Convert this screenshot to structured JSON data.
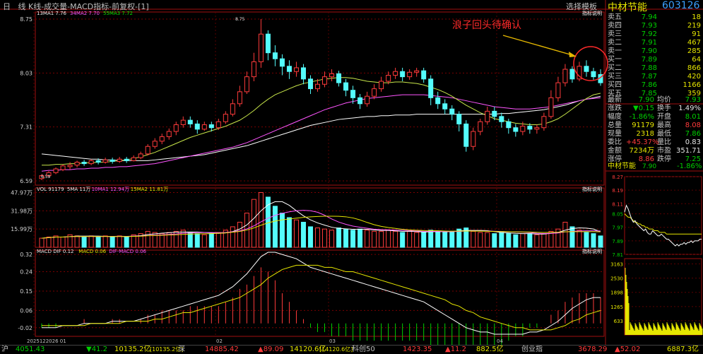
{
  "header": {
    "period_day": "日",
    "period_line": "线",
    "title": "K线-成交量-MACD指标-前复权-[1]",
    "select_template": "选择模板",
    "stock_name": "中材节能",
    "stock_code": "603126"
  },
  "price_panel": {
    "ma_legend": [
      {
        "label": "13MA1 7.76",
        "color": "#e8e8e8"
      },
      {
        "label": "34MA2 7.70",
        "color": "#ff55ff"
      },
      {
        "label": "55MA3 7.72",
        "color": "#00e000"
      }
    ],
    "indicator_btn": "指标说明",
    "y_ticks": [
      "8.75",
      "8.03",
      "7.31",
      "6.59"
    ],
    "high_label": "8.75",
    "low_label": "6.59",
    "annotation": "浪子回头待确认"
  },
  "volume_panel": {
    "legend": [
      {
        "label": "VOL 91179",
        "color": "#e8e8e8"
      },
      {
        "label": "5MA 11万",
        "color": "#e8e8e8"
      },
      {
        "label": "10MA1 12.94万",
        "color": "#ff55ff"
      },
      {
        "label": "15MA2 11.81万",
        "color": "#e6e600"
      }
    ],
    "indicator_btn": "指标说明",
    "y_ticks": [
      "47.97万",
      "31.98万",
      "15.99万"
    ]
  },
  "macd_panel": {
    "legend": [
      {
        "label": "MACD DIF 0.12",
        "color": "#e8e8e8"
      },
      {
        "label": "MACD 0.06",
        "color": "#e6e600"
      },
      {
        "label": "DIF-MACD 0.06",
        "color": "#ff55ff"
      }
    ],
    "indicator_btn": "指标说明",
    "y_ticks": [
      "0.32",
      "0.24",
      "0.15",
      "0.06",
      "-0.02"
    ]
  },
  "x_labels": [
    "2025122026 01",
    "02",
    "03",
    "04"
  ],
  "order_book": {
    "asks": [
      {
        "label": "卖五",
        "price": "7.94",
        "vol": "18"
      },
      {
        "label": "卖四",
        "price": "7.93",
        "vol": "219"
      },
      {
        "label": "卖三",
        "price": "7.92",
        "vol": "91"
      },
      {
        "label": "卖二",
        "price": "7.91",
        "vol": "467"
      },
      {
        "label": "卖一",
        "price": "7.90",
        "vol": "285"
      }
    ],
    "bids": [
      {
        "label": "买一",
        "price": "7.89",
        "vol": "64"
      },
      {
        "label": "买二",
        "price": "7.88",
        "vol": "866"
      },
      {
        "label": "买三",
        "price": "7.87",
        "vol": "420"
      },
      {
        "label": "买四",
        "price": "7.86",
        "vol": "1166"
      },
      {
        "label": "买五",
        "price": "7.85",
        "vol": "359"
      }
    ]
  },
  "stats": [
    {
      "l1": "最新",
      "v1": "7.90",
      "c1": "green",
      "l2": "均价",
      "v2": "7.93",
      "c2": "green"
    },
    {
      "l1": "涨跌",
      "v1": "▼0.15",
      "c1": "green",
      "l2": "换手",
      "v2": "1.49%",
      "c2": "white"
    },
    {
      "l1": "幅度",
      "v1": "-1.86%",
      "c1": "green",
      "l2": "开盘",
      "v2": "8.01",
      "c2": "green"
    },
    {
      "l1": "总量",
      "v1": "91179",
      "c1": "yellow",
      "l2": "最高",
      "v2": "8.08",
      "c2": "red"
    },
    {
      "l1": "现量",
      "v1": "2318",
      "c1": "yellow",
      "l2": "最低",
      "v2": "7.86",
      "c2": "green"
    },
    {
      "l1": "委比",
      "v1": "+45.37%",
      "c1": "red",
      "l2": "量比",
      "v2": "0.83",
      "c2": "white"
    },
    {
      "l1": "金额",
      "v1": "7234万",
      "c1": "yellow",
      "l2": "市盈",
      "v2": "351.71",
      "c2": "white"
    },
    {
      "l1": "涨停",
      "v1": "8.86",
      "c1": "red",
      "l2": "跌停",
      "v2": "7.25",
      "c2": "green"
    }
  ],
  "mini_chart": {
    "name": "中材节能",
    "price": "7.90",
    "change": "-1.86%",
    "price_ticks": [
      "8.27",
      "8.19",
      "8.11",
      "8.05",
      "7.97",
      "7.89",
      "7.81"
    ],
    "vol_ticks": [
      "3163",
      "2530",
      "1898",
      "1265",
      "633"
    ]
  },
  "footer": {
    "sh_label": "沪",
    "sh_val": "4051.43",
    "sh_chg": "▼41.2",
    "sh_amt": "10135.2亿",
    "sh_amt2": "[10135.2亿]",
    "sz_label": "深",
    "sz_val": "14885.42",
    "sz_chg": "▲89.09",
    "sz_amt": "14120.6亿",
    "sz_amt2": "[14120.6亿]",
    "k50_label": "科创50",
    "k50_val": "1423.35",
    "k50_chg": "▲11.2",
    "cy_label": "创业指",
    "cy_val": "882.5亿",
    "cy_val2": "3678.29",
    "cy_chg": "▲52.02",
    "last_val": "6887.3亿"
  },
  "chart_data": {
    "type": "candlestick",
    "title": "K线-成交量-MACD指标-前复权",
    "price_range": [
      6.59,
      8.75
    ],
    "candles": [
      [
        6.62,
        6.66,
        6.6,
        6.68
      ],
      [
        6.66,
        6.7,
        6.64,
        6.72
      ],
      [
        6.7,
        6.75,
        6.68,
        6.77
      ],
      [
        6.74,
        6.79,
        6.72,
        6.81
      ],
      [
        6.78,
        6.8,
        6.74,
        6.84
      ],
      [
        6.8,
        6.84,
        6.77,
        6.86
      ],
      [
        6.84,
        6.82,
        6.79,
        6.87
      ],
      [
        6.82,
        6.86,
        6.8,
        6.88
      ],
      [
        6.86,
        6.84,
        6.81,
        6.89
      ],
      [
        6.84,
        6.87,
        6.82,
        6.9
      ],
      [
        6.87,
        6.85,
        6.82,
        6.9
      ],
      [
        6.85,
        6.88,
        6.83,
        6.91
      ],
      [
        6.88,
        6.86,
        6.83,
        6.91
      ],
      [
        6.86,
        6.9,
        6.85,
        6.93
      ],
      [
        6.9,
        6.95,
        6.88,
        6.98
      ],
      [
        6.95,
        7.05,
        6.93,
        7.08
      ],
      [
        7.05,
        7.12,
        7.02,
        7.16
      ],
      [
        7.12,
        7.18,
        7.08,
        7.22
      ],
      [
        7.18,
        7.25,
        7.14,
        7.29
      ],
      [
        7.25,
        7.34,
        7.2,
        7.38
      ],
      [
        7.34,
        7.4,
        7.3,
        7.45
      ],
      [
        7.4,
        7.35,
        7.3,
        7.45
      ],
      [
        7.35,
        7.28,
        7.22,
        7.4
      ],
      [
        7.28,
        7.34,
        7.26,
        7.38
      ],
      [
        7.34,
        7.3,
        7.25,
        7.38
      ],
      [
        7.3,
        7.38,
        7.27,
        7.42
      ],
      [
        7.38,
        7.48,
        7.35,
        7.52
      ],
      [
        7.48,
        7.62,
        7.45,
        7.68
      ],
      [
        7.62,
        7.78,
        7.58,
        7.86
      ],
      [
        7.78,
        7.98,
        7.75,
        8.05
      ],
      [
        7.98,
        8.18,
        7.92,
        8.3
      ],
      [
        8.18,
        8.55,
        8.1,
        8.75
      ],
      [
        8.55,
        8.3,
        8.2,
        8.6
      ],
      [
        8.3,
        8.22,
        8.12,
        8.4
      ],
      [
        8.22,
        8.12,
        8.0,
        8.28
      ],
      [
        8.12,
        8.05,
        7.95,
        8.2
      ],
      [
        8.05,
        8.1,
        7.98,
        8.18
      ],
      [
        8.1,
        7.95,
        7.88,
        8.15
      ],
      [
        7.95,
        7.82,
        7.75,
        8.0
      ],
      [
        7.82,
        7.88,
        7.78,
        7.95
      ],
      [
        7.88,
        7.98,
        7.84,
        8.05
      ],
      [
        7.98,
        8.02,
        7.92,
        8.08
      ],
      [
        8.02,
        7.9,
        7.85,
        8.06
      ],
      [
        7.9,
        7.8,
        7.72,
        7.95
      ],
      [
        7.8,
        7.7,
        7.62,
        7.86
      ],
      [
        7.7,
        7.62,
        7.55,
        7.75
      ],
      [
        7.62,
        7.72,
        7.58,
        7.78
      ],
      [
        7.72,
        7.82,
        7.68,
        7.88
      ],
      [
        7.82,
        7.92,
        7.78,
        7.98
      ],
      [
        7.92,
        8.0,
        7.88,
        8.05
      ],
      [
        8.0,
        8.05,
        7.95,
        8.1
      ],
      [
        8.05,
        7.98,
        7.92,
        8.1
      ],
      [
        7.98,
        8.04,
        7.94,
        8.08
      ],
      [
        8.04,
        8.06,
        7.98,
        8.1
      ],
      [
        8.06,
        7.95,
        7.9,
        8.1
      ],
      [
        7.95,
        7.7,
        7.6,
        8.0
      ],
      [
        7.7,
        7.62,
        7.55,
        7.78
      ],
      [
        7.62,
        7.55,
        7.48,
        7.68
      ],
      [
        7.55,
        7.48,
        7.4,
        7.6
      ],
      [
        7.48,
        7.35,
        7.25,
        7.52
      ],
      [
        7.35,
        7.05,
        6.98,
        7.4
      ],
      [
        7.05,
        7.25,
        7.0,
        7.3
      ],
      [
        7.25,
        7.38,
        7.2,
        7.42
      ],
      [
        7.38,
        7.52,
        7.34,
        7.58
      ],
      [
        7.52,
        7.45,
        7.4,
        7.58
      ],
      [
        7.45,
        7.38,
        7.3,
        7.5
      ],
      [
        7.38,
        7.3,
        7.22,
        7.42
      ],
      [
        7.3,
        7.25,
        7.18,
        7.35
      ],
      [
        7.25,
        7.32,
        7.2,
        7.38
      ],
      [
        7.32,
        7.28,
        7.22,
        7.36
      ],
      [
        7.28,
        7.3,
        7.22,
        7.34
      ],
      [
        7.3,
        7.45,
        7.26,
        7.5
      ],
      [
        7.45,
        7.7,
        7.42,
        7.8
      ],
      [
        7.7,
        7.9,
        7.65,
        7.98
      ],
      [
        7.9,
        8.08,
        7.85,
        8.15
      ],
      [
        8.08,
        7.95,
        7.9,
        8.12
      ],
      [
        7.95,
        8.12,
        7.92,
        8.18
      ],
      [
        8.12,
        8.05,
        7.98,
        8.2
      ],
      [
        8.05,
        7.98,
        7.94,
        8.1
      ],
      [
        8.01,
        7.9,
        7.86,
        8.08
      ]
    ],
    "ma13": [
      6.8,
      6.8,
      6.81,
      6.81,
      6.82,
      6.82,
      6.83,
      6.83,
      6.84,
      6.84,
      6.85,
      6.86,
      6.87,
      6.89,
      6.91,
      6.94,
      6.97,
      7.01,
      7.05,
      7.09,
      7.13,
      7.17,
      7.2,
      7.23,
      7.26,
      7.29,
      7.32,
      7.36,
      7.4,
      7.46,
      7.53,
      7.61,
      7.68,
      7.74,
      7.78,
      7.82,
      7.86,
      7.89,
      7.91,
      7.93,
      7.95,
      7.96,
      7.97,
      7.97,
      7.96,
      7.94,
      7.92,
      7.91,
      7.9,
      7.9,
      7.91,
      7.91,
      7.9,
      7.89,
      7.87,
      7.84,
      7.81,
      7.77,
      7.72,
      7.66,
      7.6,
      7.55,
      7.5,
      7.46,
      7.42,
      7.4,
      7.38,
      7.36,
      7.35,
      7.34,
      7.34,
      7.35,
      7.38,
      7.42,
      7.48,
      7.55,
      7.62,
      7.69,
      7.74,
      7.76
    ],
    "ma34": [
      6.72,
      6.73,
      6.73,
      6.74,
      6.74,
      6.75,
      6.75,
      6.76,
      6.76,
      6.77,
      6.77,
      6.78,
      6.78,
      6.79,
      6.8,
      6.81,
      6.82,
      6.84,
      6.86,
      6.88,
      6.9,
      6.92,
      6.94,
      6.96,
      6.98,
      7.0,
      7.02,
      7.04,
      7.07,
      7.1,
      7.14,
      7.18,
      7.22,
      7.26,
      7.3,
      7.34,
      7.38,
      7.42,
      7.46,
      7.5,
      7.54,
      7.57,
      7.6,
      7.63,
      7.65,
      7.67,
      7.69,
      7.7,
      7.71,
      7.72,
      7.73,
      7.74,
      7.74,
      7.74,
      7.74,
      7.73,
      7.72,
      7.71,
      7.7,
      7.68,
      7.66,
      7.64,
      7.62,
      7.6,
      7.58,
      7.57,
      7.56,
      7.55,
      7.55,
      7.55,
      7.56,
      7.57,
      7.58,
      7.6,
      7.62,
      7.64,
      7.66,
      7.68,
      7.69,
      7.7
    ],
    "ma55": [
      6.95,
      6.94,
      6.93,
      6.92,
      6.91,
      6.9,
      6.89,
      6.88,
      6.88,
      6.87,
      6.87,
      6.86,
      6.86,
      6.86,
      6.86,
      6.86,
      6.87,
      6.88,
      6.89,
      6.9,
      6.91,
      6.92,
      6.93,
      6.94,
      6.96,
      6.98,
      7.0,
      7.02,
      7.04,
      7.06,
      7.09,
      7.12,
      7.15,
      7.18,
      7.21,
      7.24,
      7.27,
      7.3,
      7.33,
      7.35,
      7.37,
      7.39,
      7.41,
      7.42,
      7.43,
      7.44,
      7.45,
      7.45,
      7.46,
      7.46,
      7.47,
      7.47,
      7.47,
      7.48,
      7.48,
      7.48,
      7.48,
      7.48,
      7.48,
      7.48,
      7.48,
      7.48,
      7.48,
      7.48,
      7.48,
      7.49,
      7.49,
      7.5,
      7.51,
      7.52,
      7.53,
      7.54,
      7.56,
      7.58,
      7.6,
      7.63,
      7.66,
      7.68,
      7.7,
      7.72
    ],
    "volume_range": [
      0,
      52
    ],
    "volume": [
      8,
      9,
      10,
      9,
      11,
      10,
      9,
      10,
      9,
      10,
      9,
      10,
      9,
      11,
      12,
      14,
      13,
      12,
      13,
      14,
      15,
      13,
      12,
      11,
      12,
      13,
      15,
      18,
      22,
      30,
      42,
      48,
      44,
      36,
      30,
      26,
      24,
      22,
      18,
      17,
      16,
      15,
      17,
      16,
      15,
      16,
      15,
      14,
      14,
      15,
      14,
      13,
      14,
      13,
      13,
      15,
      14,
      13,
      14,
      16,
      17,
      14,
      13,
      13,
      12,
      13,
      12,
      11,
      12,
      12,
      11,
      12,
      14,
      16,
      22,
      18,
      15,
      13,
      12,
      10
    ],
    "macd_range": [
      -0.06,
      0.34
    ],
    "dif": [
      -0.02,
      -0.02,
      -0.02,
      -0.01,
      -0.01,
      -0.01,
      0.0,
      0.0,
      0.0,
      0.0,
      0.01,
      0.01,
      0.01,
      0.01,
      0.02,
      0.03,
      0.04,
      0.05,
      0.06,
      0.07,
      0.08,
      0.09,
      0.1,
      0.11,
      0.12,
      0.13,
      0.15,
      0.17,
      0.2,
      0.23,
      0.27,
      0.31,
      0.33,
      0.33,
      0.32,
      0.31,
      0.3,
      0.28,
      0.26,
      0.25,
      0.24,
      0.23,
      0.22,
      0.21,
      0.2,
      0.19,
      0.18,
      0.17,
      0.16,
      0.15,
      0.14,
      0.13,
      0.12,
      0.11,
      0.1,
      0.08,
      0.06,
      0.04,
      0.02,
      0.0,
      -0.02,
      -0.03,
      -0.04,
      -0.04,
      -0.05,
      -0.05,
      -0.05,
      -0.05,
      -0.05,
      -0.04,
      -0.04,
      -0.03,
      -0.01,
      0.01,
      0.04,
      0.07,
      0.09,
      0.11,
      0.12,
      0.12
    ],
    "dea": [
      -0.01,
      -0.01,
      -0.01,
      -0.01,
      -0.01,
      -0.01,
      -0.01,
      0.0,
      0.0,
      0.0,
      0.0,
      0.0,
      0.01,
      0.01,
      0.01,
      0.01,
      0.02,
      0.02,
      0.03,
      0.04,
      0.05,
      0.05,
      0.06,
      0.07,
      0.08,
      0.09,
      0.1,
      0.11,
      0.12,
      0.14,
      0.16,
      0.18,
      0.21,
      0.23,
      0.25,
      0.26,
      0.27,
      0.27,
      0.27,
      0.27,
      0.26,
      0.26,
      0.25,
      0.24,
      0.24,
      0.23,
      0.22,
      0.21,
      0.2,
      0.19,
      0.18,
      0.17,
      0.16,
      0.15,
      0.14,
      0.13,
      0.12,
      0.11,
      0.09,
      0.08,
      0.06,
      0.05,
      0.03,
      0.02,
      0.01,
      0.0,
      -0.01,
      -0.02,
      -0.02,
      -0.03,
      -0.03,
      -0.03,
      -0.03,
      -0.02,
      -0.01,
      0.01,
      0.02,
      0.04,
      0.05,
      0.06
    ],
    "mini_price_range": [
      7.81,
      8.27
    ],
    "mini_price": [
      8.06,
      8.1,
      8.08,
      8.05,
      8.02,
      8.0,
      8.01,
      7.99,
      7.98,
      7.97,
      7.96,
      7.95,
      7.96,
      7.94,
      7.93,
      7.93,
      7.95,
      7.94,
      7.93,
      7.92,
      7.92,
      7.93,
      7.92,
      7.91,
      7.9,
      7.9,
      7.89,
      7.88,
      7.87,
      7.86,
      7.87,
      7.86,
      7.87,
      7.87,
      7.88,
      7.87,
      7.88,
      7.88,
      7.89,
      7.88,
      7.89,
      7.89,
      7.89,
      7.9,
      7.9
    ],
    "mini_avg": [
      8.05,
      8.04,
      8.03,
      8.03,
      8.02,
      8.01,
      8.0,
      8.0,
      7.99,
      7.99,
      7.98,
      7.98,
      7.97,
      7.97,
      7.96,
      7.96,
      7.96,
      7.95,
      7.95,
      7.95,
      7.94,
      7.94,
      7.94,
      7.94,
      7.93,
      7.93,
      7.93,
      7.93,
      7.93,
      7.93,
      7.93,
      7.93,
      7.93,
      7.93,
      7.93,
      7.93,
      7.93,
      7.93,
      7.93,
      7.93,
      7.93,
      7.93,
      7.93,
      7.93,
      7.93
    ]
  }
}
